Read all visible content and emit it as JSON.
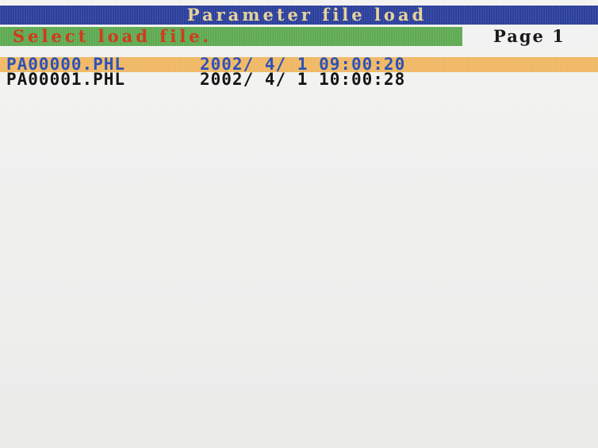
{
  "header": {
    "title": "Parameter file load"
  },
  "prompt": {
    "message": "Select load file.",
    "page_label": "Page",
    "page_number": "1"
  },
  "files": [
    {
      "name": "PA00000.PHL",
      "date": "2002/ 4/ 1 09:00:20",
      "selected": true
    },
    {
      "name": "PA00001.PHL",
      "date": "2002/ 4/ 1 10:00:28",
      "selected": false
    }
  ],
  "colors": {
    "title_bar": "#2b3f9c",
    "title_text": "#e6d39a",
    "prompt_bar": "#5faa52",
    "prompt_text": "#d23a1c",
    "selection_bar": "#f0b865",
    "selection_text": "#2d52b8",
    "background": "#f1f1f0"
  }
}
